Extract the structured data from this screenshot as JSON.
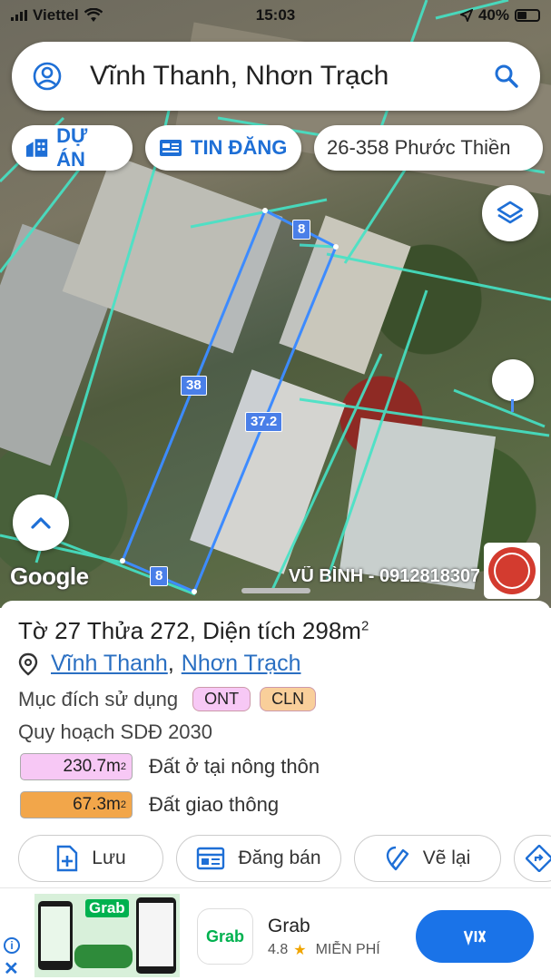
{
  "status_bar": {
    "carrier": "Viettel",
    "time": "15:03",
    "battery": "40%"
  },
  "search": {
    "query": "Vĩnh Thanh, Nhơn Trạch"
  },
  "chips": {
    "projects": "DỰ ÁN",
    "listings": "TIN ĐĂNG",
    "address": "26-358 Phước Thiền"
  },
  "map": {
    "edge_labels": {
      "top": "8",
      "left": "38",
      "right": "37.2",
      "bottom": "8"
    },
    "google_logo": "Google",
    "watermark": "VŨ BÌNH - 0912818307",
    "stamp": {
      "name": "VŨ BÌNH",
      "phone": "0912 818 307"
    }
  },
  "parcel": {
    "title_prefix": "Tờ 27 Thửa 272, Diện tích 298m",
    "title_sup": "2",
    "commune": "Vĩnh Thanh",
    "district": "Nhơn Trạch",
    "separator": ",",
    "purpose_label": "Mục đích sử dụng",
    "purpose_tags": [
      "ONT",
      "CLN"
    ],
    "plan_label": "Quy hoạch SDĐ 2030",
    "areas": [
      {
        "value": "230.7m",
        "sup": "2",
        "desc": "Đất ở tại nông thôn",
        "color": "#f7c8f5"
      },
      {
        "value": "67.3m",
        "sup": "2",
        "desc": "Đất giao thông",
        "color": "#f2a64a"
      }
    ]
  },
  "actions": {
    "save": "Lưu",
    "post": "Đăng bán",
    "redraw": "Vẽ lại"
  },
  "ad": {
    "brand": "Grab",
    "app_name": "Grab",
    "rating": "4.8",
    "price": "MIỄN PHÍ",
    "info": "i",
    "close": "✕"
  },
  "colors": {
    "accent": "#1e6fd6",
    "parcel_line": "#3d8bff",
    "boundary_line": "#45e3c6"
  }
}
